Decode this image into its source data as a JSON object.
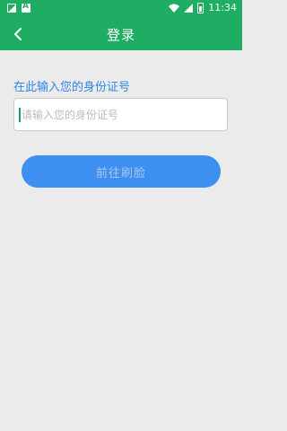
{
  "status_bar": {
    "time": "11:34",
    "icons": [
      "image-icon",
      "font-icon",
      "wifi-icon",
      "signal-icon",
      "battery-icon"
    ]
  },
  "app_bar": {
    "title": "登录",
    "back_icon": "chevron-left-icon"
  },
  "form": {
    "label": "在此输入您的身份证号",
    "input_value": "",
    "input_placeholder": "请输入您的身份证号",
    "submit_label": "前往刷脸"
  },
  "colors": {
    "primary_green": "#1fad63",
    "label_blue": "#2f86e8",
    "button_blue": "#3d8ff0",
    "button_text": "#aac9ef",
    "background": "#ebebeb"
  }
}
